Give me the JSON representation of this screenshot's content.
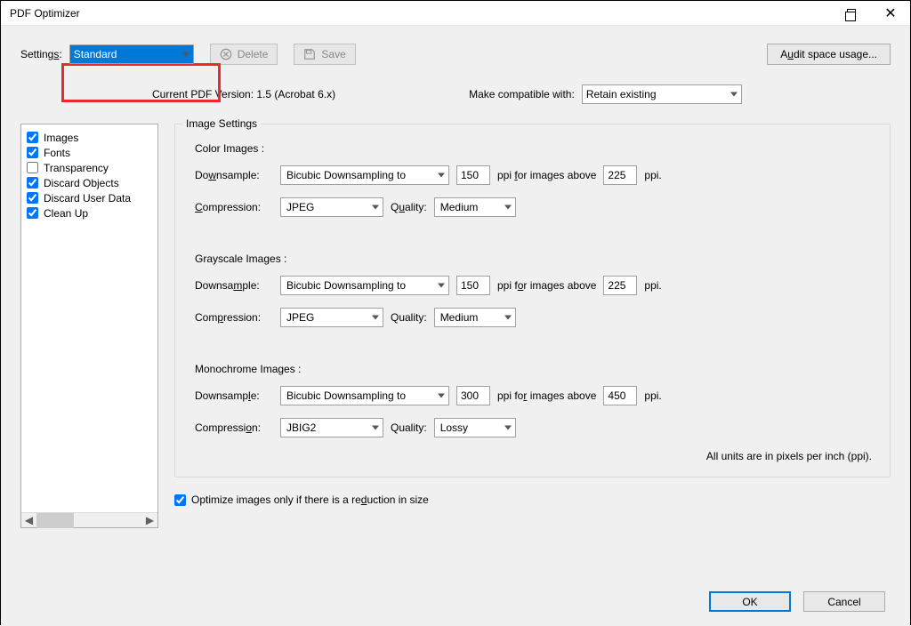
{
  "window": {
    "title": "PDF Optimizer"
  },
  "toolbar": {
    "settings_label": "Settings:",
    "settings_value": "Standard",
    "delete_label": "Delete",
    "save_label": "Save",
    "audit_label": "Audit space usage..."
  },
  "version": {
    "current_pdf_version": "Current PDF Version: 1.5 (Acrobat 6.x)",
    "compat_label": "Make compatible with:",
    "compat_value": "Retain existing"
  },
  "categories": [
    {
      "key": "images",
      "label": "Images",
      "checked": true
    },
    {
      "key": "fonts",
      "label": "Fonts",
      "checked": true
    },
    {
      "key": "transparency",
      "label": "Transparency",
      "checked": false
    },
    {
      "key": "discard-objects",
      "label": "Discard Objects",
      "checked": true
    },
    {
      "key": "discard-user-data",
      "label": "Discard User Data",
      "checked": true
    },
    {
      "key": "cleanup",
      "label": "Clean Up",
      "checked": true
    }
  ],
  "image_settings": {
    "fieldset_title": "Image Settings",
    "labels": {
      "downsample": "Downsample:",
      "compression": "Compression:",
      "quality": "Quality:",
      "for_images_above": "ppi for images above",
      "ppi": "ppi."
    },
    "color": {
      "title": "Color Images :",
      "downsample_method": "Bicubic Downsampling to",
      "downsample_to": "150",
      "threshold": "225",
      "compression": "JPEG",
      "quality": "Medium"
    },
    "grayscale": {
      "title": "Grayscale Images :",
      "downsample_method": "Bicubic Downsampling to",
      "downsample_to": "150",
      "threshold": "225",
      "compression": "JPEG",
      "quality": "Medium"
    },
    "mono": {
      "title": "Monochrome Images :",
      "downsample_method": "Bicubic Downsampling to",
      "downsample_to": "300",
      "threshold": "450",
      "compression": "JBIG2",
      "quality": "Lossy"
    },
    "units_note": "All units are in pixels per inch (ppi).",
    "optimize_reduction_label": "Optimize images only if there is a reduction in size",
    "optimize_reduction_checked": true
  },
  "buttons": {
    "ok": "OK",
    "cancel": "Cancel"
  }
}
